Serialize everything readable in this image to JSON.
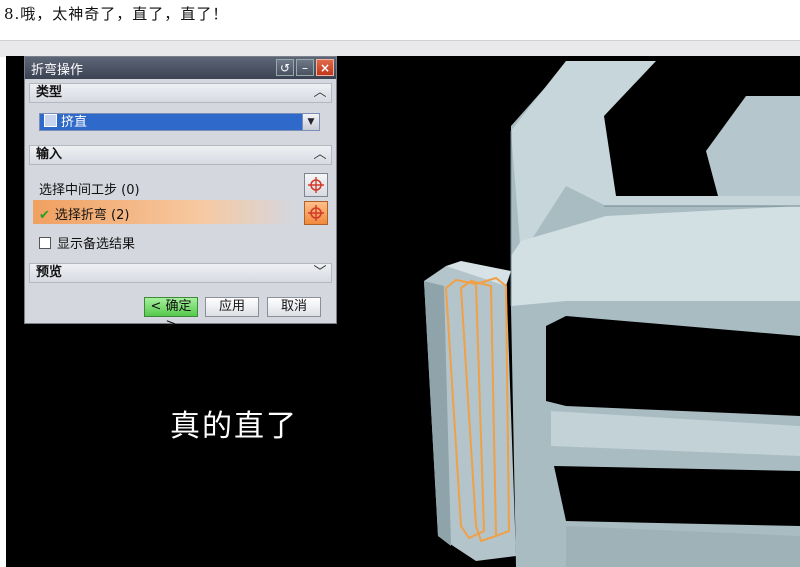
{
  "caption": "8.哦，太神奇了，直了，直了！",
  "overlay_text": "真的直了",
  "dialog": {
    "title": "折弯操作",
    "title_buttons": [
      "reset-icon",
      "minimize-icon",
      "close-icon"
    ],
    "sections": {
      "type": {
        "label": "类型",
        "chevron": "^"
      },
      "input": {
        "label": "输入",
        "chevron": "^"
      },
      "preview": {
        "label": "预览",
        "chevron": "v"
      }
    },
    "type_select": {
      "value": "挤直"
    },
    "input_rows": {
      "intermediate_step": "选择中间工步 (0)",
      "select_bends": "选择折弯 (2)",
      "show_alternative": "显示备选结果"
    },
    "buttons": {
      "ok": "< 确定 >",
      "apply": "应用",
      "cancel": "取消"
    }
  },
  "colors": {
    "viewport_bg": "#000000",
    "model_fill": "#b9cbd0",
    "highlight_edge": "#f0a046",
    "select_bg": "#2f69c9",
    "ok_button": "#56c94d"
  }
}
